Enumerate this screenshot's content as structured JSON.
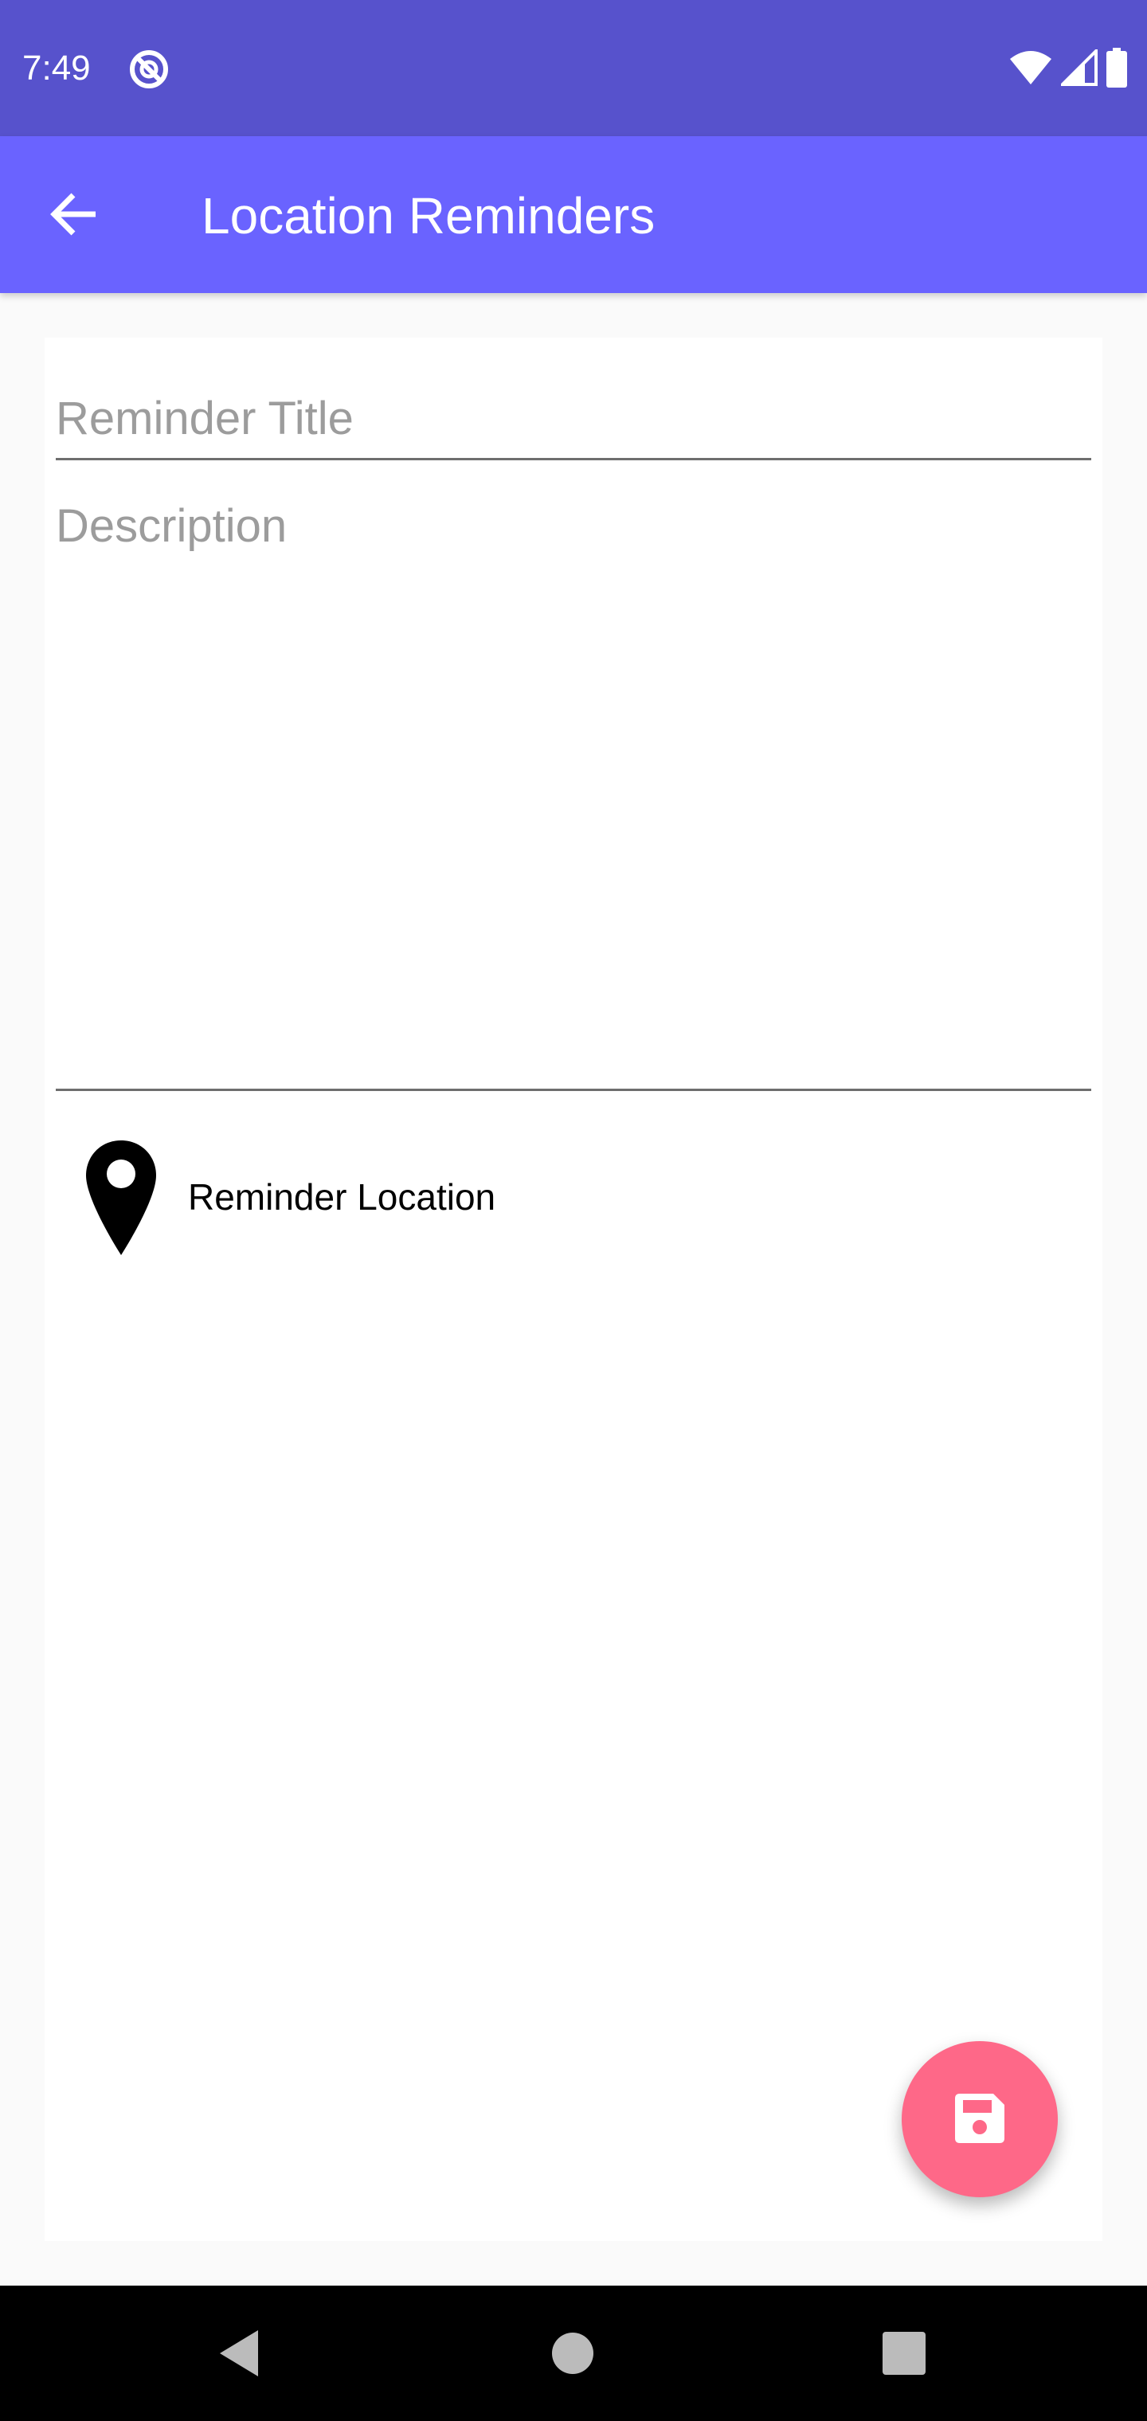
{
  "status_bar": {
    "time": "7:49",
    "icons": [
      "sync-off-icon",
      "wifi-icon",
      "signal-icon",
      "battery-icon"
    ],
    "color": "#5752cc"
  },
  "app_bar": {
    "title": "Location Reminders",
    "back_icon": "arrow-back-icon",
    "color": "#6a63ff"
  },
  "form": {
    "title_placeholder": "Reminder Title",
    "title_value": "",
    "description_placeholder": "Description",
    "description_value": "",
    "location_label": "Reminder Location",
    "location_icon": "map-pin-icon"
  },
  "fab": {
    "icon": "save-icon",
    "color": "#fe6888"
  },
  "nav_bar": {
    "icons": [
      "nav-back-icon",
      "nav-home-icon",
      "nav-recents-icon"
    ]
  }
}
